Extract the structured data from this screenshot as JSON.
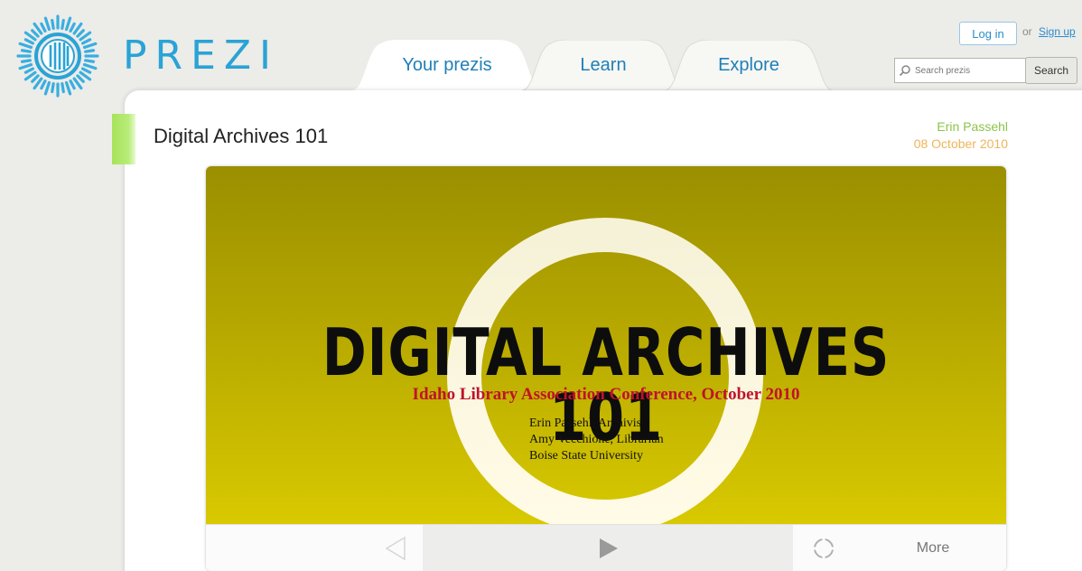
{
  "brand": {
    "name": "PREZI",
    "icon": "prezi-logo-icon",
    "color": "#2aa3d6"
  },
  "nav": {
    "tabs": [
      {
        "label": "Your prezis"
      },
      {
        "label": "Learn"
      },
      {
        "label": "Explore"
      }
    ]
  },
  "account": {
    "login_label": "Log in",
    "or_text": "or",
    "signup_label": "Sign up"
  },
  "search": {
    "placeholder": "Search prezis",
    "button_label": "Search",
    "icon": "search-icon"
  },
  "presentation": {
    "title": "Digital Archives 101",
    "author": "Erin Passehl",
    "date": "08 October 2010",
    "author_color": "#8cc44a",
    "date_color": "#f0b45a"
  },
  "slide": {
    "title": "DIGITAL ARCHIVES 101",
    "subtitle": "Idaho Library Association Conference, October 2010",
    "credits": [
      "Erin Passehl, Archivist",
      "Amy Vecchione, Librarian",
      "Boise State University"
    ],
    "background_top": "#9a8f00",
    "background_bottom": "#d8c900",
    "subtitle_color": "#c0122b"
  },
  "controls": {
    "previous_icon": "previous-arrow-icon",
    "play_icon": "play-icon",
    "fullscreen_icon": "fullscreen-icon",
    "more_label": "More"
  }
}
